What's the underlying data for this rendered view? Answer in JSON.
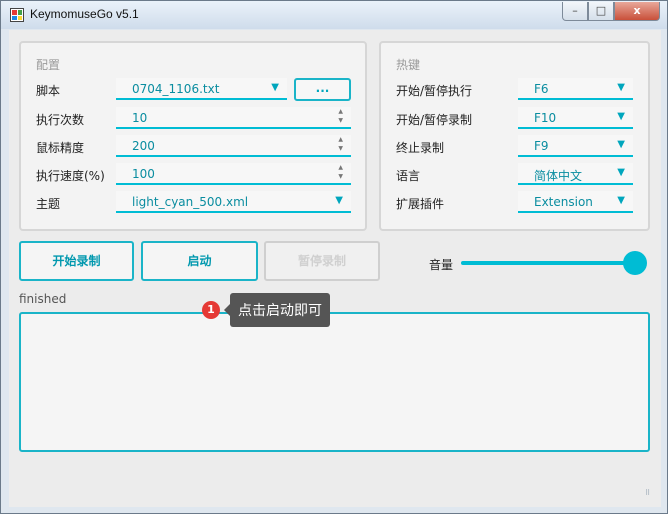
{
  "window": {
    "title": "KeymomuseGo v5.1",
    "min": "–",
    "max": "□",
    "close": "x"
  },
  "config": {
    "title": "配置",
    "script_label": "脚本",
    "script_value": "0704_1106.txt",
    "browse_label": "...",
    "count_label": "执行次数",
    "count_value": "10",
    "precision_label": "鼠标精度",
    "precision_value": "200",
    "speed_label": "执行速度(%)",
    "speed_value": "100",
    "theme_label": "主题",
    "theme_value": "light_cyan_500.xml"
  },
  "hotkeys": {
    "title": "热键",
    "rows": [
      {
        "label": "开始/暂停执行",
        "value": "F6"
      },
      {
        "label": "开始/暂停录制",
        "value": "F10"
      },
      {
        "label": "终止录制",
        "value": "F9"
      },
      {
        "label": "语言",
        "value": "简体中文"
      },
      {
        "label": "扩展插件",
        "value": "Extension"
      }
    ]
  },
  "actions": {
    "start_record": "开始录制",
    "launch": "启动",
    "pause_record": "暂停录制",
    "volume_label": "音量"
  },
  "volume": {
    "level": 1.0
  },
  "status": "finished",
  "tooltip": {
    "badge": "1",
    "text": "点击启动即可"
  },
  "icons": {
    "dropdown": "▼",
    "spin_up": "▲",
    "spin_down": "▼",
    "grip": "⠿"
  },
  "colors": {
    "accent": "#00bcd4",
    "badge": "#e53935"
  }
}
